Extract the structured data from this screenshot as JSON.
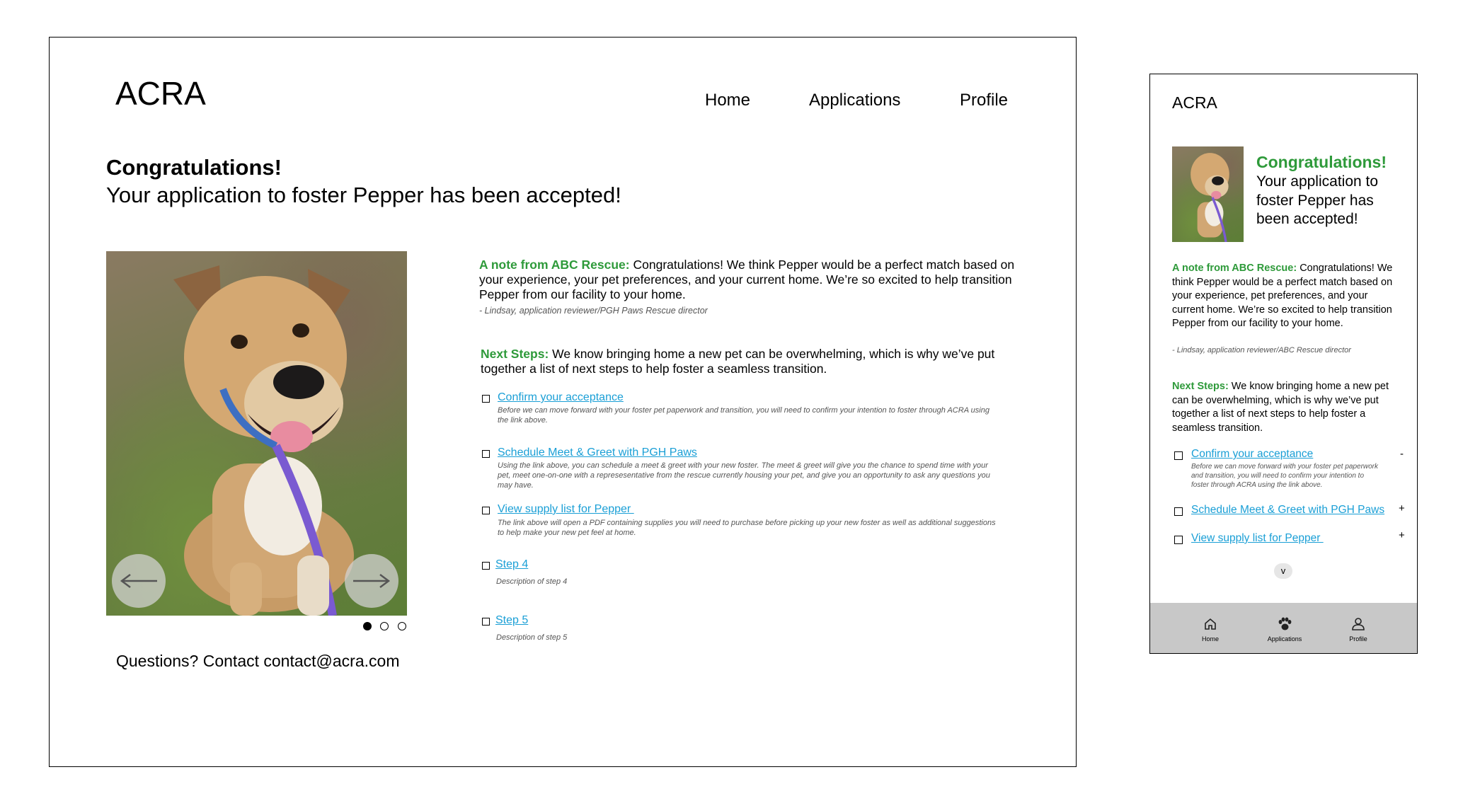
{
  "desktop": {
    "logo": "ACRA",
    "nav": [
      "Home",
      "Applications",
      "Profile"
    ],
    "heading_bold": "Congratulations!",
    "heading_sub": "Your application to foster Pepper has been accepted!",
    "note_label": "A note from ABC Rescue:",
    "note_text": " Congratulations! We think Pepper would be a perfect match based on your experience, your pet preferences, and your current home. We’re so excited to help transition Pepper from our facility to your home.",
    "note_sign": "- Lindsay, application reviewer/PGH Paws Rescue director",
    "next_label": "Next Steps:",
    "next_text": " We know bringing home a new pet can be overwhelming, which is why we’ve put together a list of next steps to help foster a seamless transition.",
    "steps": [
      {
        "title": "Confirm your acceptance",
        "desc": "Before we can move forward with your foster pet paperwork and transition, you will need to confirm your intention to foster through ACRA using the link above."
      },
      {
        "title": "Schedule Meet & Greet with PGH Paws",
        "desc": "Using the link above, you can schedule a meet & greet with your new foster. The meet & greet will give you the chance to spend time with your pet, meet one-on-one with a represesentative from the rescue currently housing your pet, and give you an opportunity to ask any questions you may have."
      },
      {
        "title": "View supply list for Pepper ",
        "desc": "The link above will open a PDF containing supplies you will need to purchase before picking up your new foster as well as additional suggestions to help make your new pet feel at home."
      },
      {
        "title": "Step 4",
        "desc": "Description of step 4"
      },
      {
        "title": "Step 5",
        "desc": "Description of step 5"
      }
    ],
    "contact": "Questions? Contact contact@acra.com",
    "carousel_dots": 3,
    "carousel_active": 0
  },
  "mobile": {
    "logo": "ACRA",
    "heading_bold": "Congratulations!",
    "heading_sub": "Your application to foster Pepper has been accepted!",
    "note_label": "A note from ABC Rescue:",
    "note_text": " Congratulations! We think Pepper would be a perfect match based on your experience, pet preferences, and your current home. We’re so excited to help transition Pepper from our facility to your home.",
    "note_sign": "- Lindsay, application reviewer/ABC Rescue director",
    "next_label": "Next Steps:",
    "next_text": " We know bringing home a new pet can be overwhelming, which is why we’ve put together a list of next steps to help foster a seamless transition.",
    "steps": [
      {
        "title": "Confirm your acceptance",
        "toggle": "-",
        "desc": "Before we can move forward with your foster pet paperwork and transition, you will need to confirm your intention to foster through ACRA using the link above."
      },
      {
        "title": "Schedule Meet & Greet with PGH Paws",
        "toggle": "+"
      },
      {
        "title": "View supply list for Pepper ",
        "toggle": "+"
      }
    ],
    "expand": "v",
    "tabbar": [
      "Home",
      "Applications",
      "Profile"
    ]
  },
  "colors": {
    "accent_green": "#2e9a3a",
    "link_blue": "#1a9fd6",
    "tabbar_bg": "#c8c8c8"
  }
}
